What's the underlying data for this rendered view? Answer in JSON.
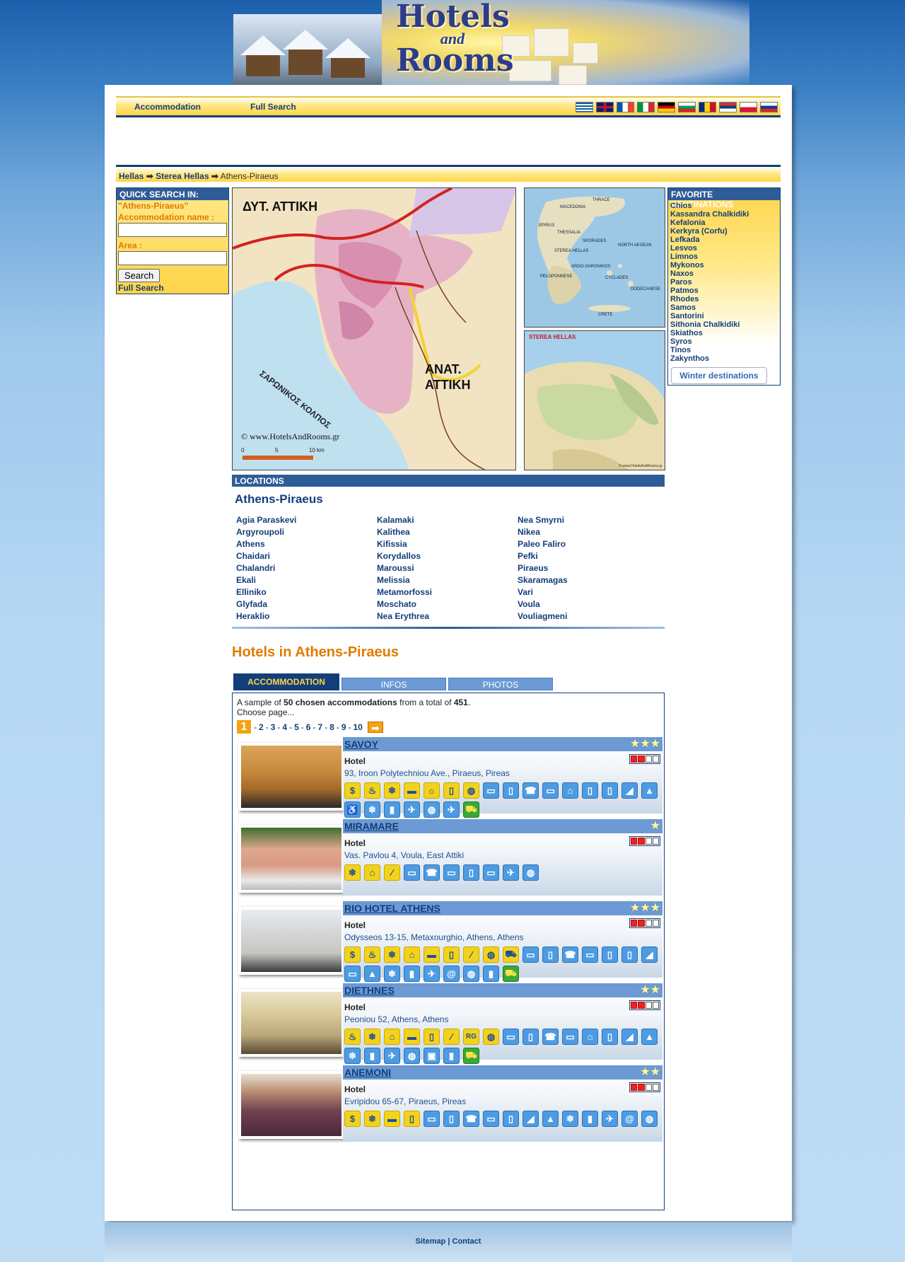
{
  "logo": {
    "line1": "Hotels",
    "line2": "and",
    "line3": "Rooms"
  },
  "nav": {
    "accommodation": "Accommodation",
    "full_search": "Full Search"
  },
  "flags": [
    "greek-flag",
    "english-flag",
    "french-flag",
    "italian-flag",
    "german-flag",
    "bulgarian-flag",
    "romanian-flag",
    "serbian-flag",
    "polish-flag",
    "russian-flag"
  ],
  "breadcrumb": {
    "item1": "Hellas",
    "item2": "Sterea Hellas",
    "current": "Athens-Piraeus"
  },
  "quick_search": {
    "title": "QUICK SEARCH IN:",
    "region": "\"Athens-Piraeus\"",
    "name_label": "Accommodation name :",
    "name_value": "",
    "area_label": "Area :",
    "area_value": "",
    "search_button": "Search",
    "full_search": "Full Search"
  },
  "maps": {
    "main": {
      "west_label": "ΔΥΤ. ΑΤΤΙΚΗ",
      "east_label1": "ΑΝΑΤ.",
      "east_label2": "ΑΤΤΙΚΗ",
      "gulf_label": "ΣΑΡΩΝΙΚΟΣ ΚΟΛΠΟΣ",
      "copyright": "© www.HotelsAndRooms.gr",
      "scale_0": "0",
      "scale_5": "5",
      "scale_10": "10 km"
    },
    "greece": {
      "labels": [
        "THRACE",
        "MACEDONIA",
        "EPIRUS",
        "THESSALIA",
        "SPORADES",
        "NORTH AEGEAN",
        "STEREA HELLAS",
        "ARGO-SARONIKOS",
        "PELOPONNESE",
        "CYCLADES",
        "DODECANESE",
        "CRETE"
      ]
    },
    "sterea": {
      "title": "STEREA HELLAS",
      "copyright": "© www.HotelsAndRooms.gr"
    }
  },
  "favorites": {
    "title": "FAVORITE DESTINATIONS",
    "items": [
      "Chios",
      "Kassandra Chalkidiki",
      "Kefalonia",
      "Kerkyra (Corfu)",
      "Lefkada",
      "Lesvos",
      "Limnos",
      "Mykonos",
      "Naxos",
      "Paros",
      "Patmos",
      "Rhodes",
      "Samos",
      "Santorini",
      "Sithonia Chalkidiki",
      "Skiathos",
      "Syros",
      "Tinos",
      "Zakynthos"
    ],
    "winter_button": "Winter destinations"
  },
  "locations": {
    "header": "LOCATIONS",
    "title": "Athens-Piraeus",
    "items": [
      "Agia Paraskevi",
      "Argyroupoli",
      "Athens",
      "Chaidari",
      "Chalandri",
      "Ekali",
      "Elliniko",
      "Glyfada",
      "Heraklio",
      "Kalamaki",
      "Kalithea",
      "Kifissia",
      "Korydallos",
      "Maroussi",
      "Melissia",
      "Metamorfossi",
      "Moschato",
      "Nea Erythrea",
      "Nea Smyrni",
      "Nikea",
      "Paleo Faliro",
      "Pefki",
      "Piraeus",
      "Skaramagas",
      "Vari",
      "Voula",
      "Vouliagmeni"
    ]
  },
  "hotels_heading": "Hotels in Athens-Piraeus",
  "tabs": [
    "ACCOMMODATION",
    "INFOS",
    "PHOTOS"
  ],
  "sample": {
    "prefix": "A sample of",
    "count": "50 chosen accommodations",
    "middle": "from a total of",
    "total": "451",
    "suffix": ".",
    "choose": "Choose page..."
  },
  "pager": {
    "current": "1",
    "pages": [
      "2",
      "3",
      "4",
      "5",
      "6",
      "7",
      "8",
      "9",
      "10"
    ],
    "next_icon": "next-arrow-icon"
  },
  "hotels": [
    {
      "name": "SAVOY",
      "stars": "★★★",
      "star_count": 3,
      "type": "Hotel",
      "address": "93, Iroon Polytechniou Ave., Piraeus, Pireas",
      "icons": [
        "y:$",
        "y:♨",
        "y:❄",
        "y:▬",
        "y:☼",
        "y:▯",
        "y:◍",
        "b:▭",
        "b:▯",
        "b:☎",
        "b:▭",
        "b:⌂",
        "b:▯",
        "b:▯",
        "b:◢",
        "b:▲",
        "b:♿",
        "b:❄",
        "b:▮",
        "b:✈",
        "b:◍",
        "b:✈",
        "g:⛟"
      ]
    },
    {
      "name": "MIRAMARE",
      "stars": "★",
      "star_count": 1,
      "type": "Hotel",
      "address": "Vas. Pavlou 4, Voula, East Attiki",
      "icons": [
        "y:❄",
        "y:⌂",
        "y:∕",
        "b:▭",
        "b:☎",
        "b:▭",
        "b:▯",
        "b:▭",
        "b:✈",
        "b:◍"
      ]
    },
    {
      "name": "RIO HOTEL ATHENS",
      "stars": "★★★",
      "star_count": 3,
      "type": "Hotel",
      "address": "Odysseos 13-15, Metaxourghio, Athens, Athens",
      "icons": [
        "y:$",
        "y:♨",
        "y:❄",
        "y:⌂",
        "y:▬",
        "y:▯",
        "y:∕",
        "y:◍",
        "y:⛟",
        "b:▭",
        "b:▯",
        "b:☎",
        "b:▭",
        "b:▯",
        "b:▯",
        "b:◢",
        "b:▭",
        "b:▲",
        "b:❄",
        "b:▮",
        "b:✈",
        "b:@",
        "b:◍",
        "b:▮",
        "g:⛟"
      ]
    },
    {
      "name": "DIETHNES",
      "stars": "★★",
      "star_count": 2,
      "type": "Hotel",
      "address": "Peoniou 52, Athens, Athens",
      "icons": [
        "y:♨",
        "y:❄",
        "y:⌂",
        "y:▬",
        "y:▯",
        "y:∕",
        "y:RG",
        "y:◍",
        "b:▭",
        "b:▯",
        "b:☎",
        "b:▭",
        "b:⌂",
        "b:▯",
        "b:◢",
        "b:▲",
        "b:❄",
        "b:▮",
        "b:✈",
        "b:◍",
        "b:▣",
        "b:▮",
        "g:⛟"
      ]
    },
    {
      "name": "ANEMONI",
      "stars": "★★",
      "star_count": 2,
      "type": "Hotel",
      "address": "Evripidou 65-67, Piraeus, Pireas",
      "icons": [
        "y:$",
        "y:❄",
        "y:▬",
        "y:▯",
        "b:▭",
        "b:▯",
        "b:☎",
        "b:▭",
        "b:▯",
        "b:◢",
        "b:▲",
        "b:❄",
        "b:▮",
        "b:✈",
        "b:@",
        "b:◍"
      ]
    }
  ],
  "footer": {
    "sitemap": "Sitemap",
    "sep": "|",
    "contact": "Contact"
  }
}
